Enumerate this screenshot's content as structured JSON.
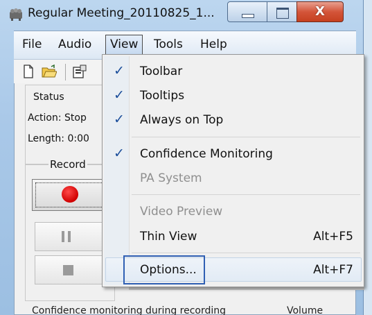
{
  "window": {
    "title": "Regular Meeting_20110825_1...",
    "minimize_icon": "minimize-icon",
    "maximize_icon": "maximize-icon",
    "close_icon": "close-icon",
    "close_glyph": "X"
  },
  "menubar": {
    "items": [
      {
        "label": "File"
      },
      {
        "label": "Audio"
      },
      {
        "label": "View"
      },
      {
        "label": "Tools"
      },
      {
        "label": "Help"
      }
    ]
  },
  "toolbar": {
    "icons": [
      "new-document-icon",
      "open-folder-icon",
      "properties-icon"
    ]
  },
  "status": {
    "title": "Status",
    "action": "Action: Stop",
    "length": "Length: 0:00"
  },
  "record": {
    "title": "Record"
  },
  "footer": {
    "left_text": "Confidence monitoring during recording",
    "right_text": "Volume"
  },
  "view_menu": {
    "check_glyph": "✓",
    "items": [
      {
        "label": "Toolbar",
        "checked": true,
        "shortcut": ""
      },
      {
        "label": "Tooltips",
        "checked": true,
        "shortcut": ""
      },
      {
        "label": "Always on Top",
        "checked": true,
        "shortcut": ""
      },
      {
        "label": "Confidence Monitoring",
        "checked": true,
        "shortcut": ""
      },
      {
        "label": "PA System",
        "checked": false,
        "disabled": true,
        "shortcut": ""
      },
      {
        "label": "Video Preview",
        "checked": false,
        "disabled": true,
        "shortcut": ""
      },
      {
        "label": "Thin View",
        "checked": false,
        "shortcut": "Alt+F5"
      },
      {
        "label": "Options...",
        "checked": false,
        "shortcut": "Alt+F7"
      }
    ]
  },
  "colors": {
    "accent_check": "#1a4d9a",
    "highlight_box": "#2f5fb3",
    "record_red": "#d00000"
  }
}
